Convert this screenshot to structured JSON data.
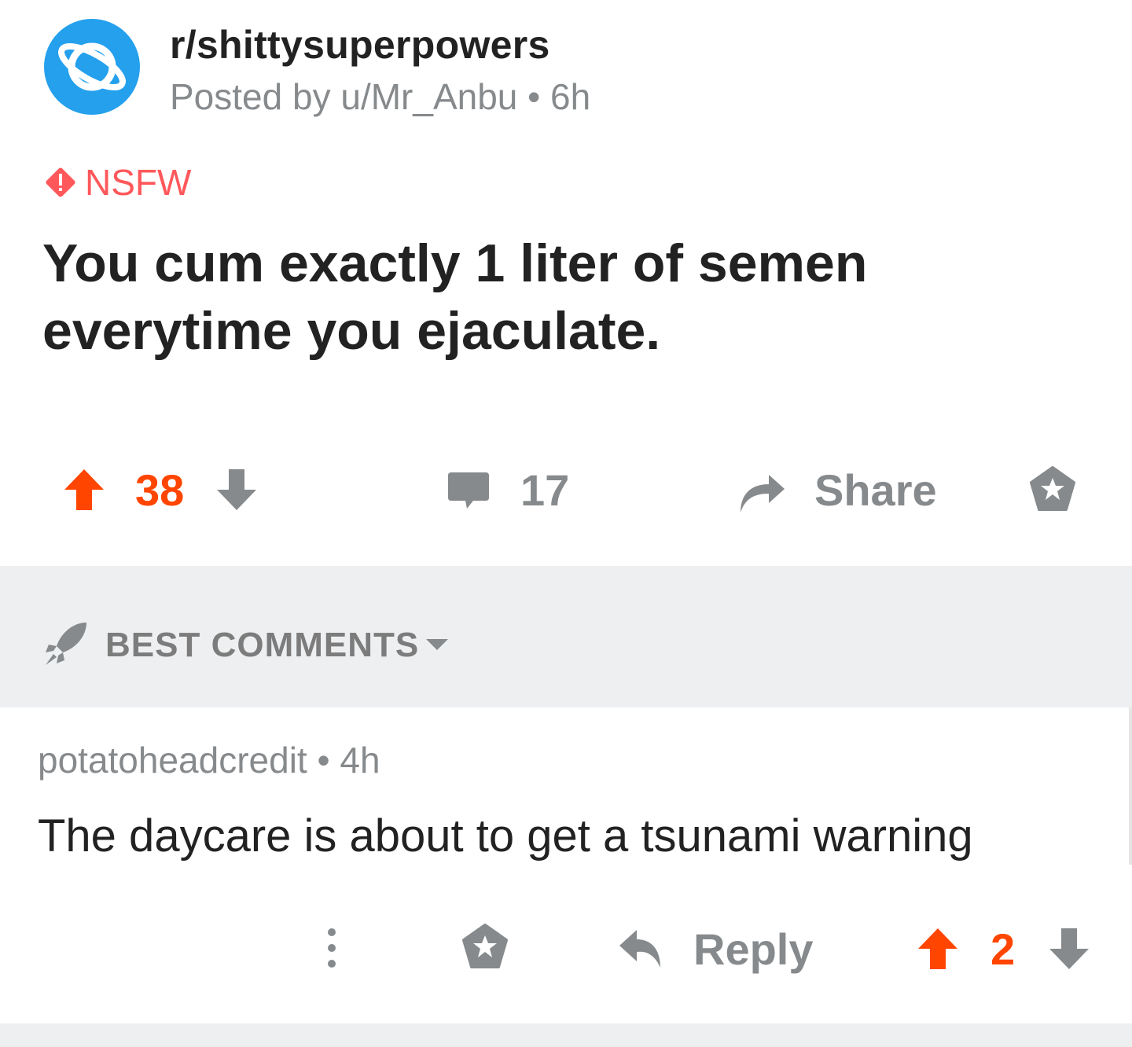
{
  "post": {
    "subreddit": "r/shittysuperpowers",
    "meta": "Posted by u/Mr_Anbu • 6h",
    "nsfw_label": "NSFW",
    "title": "You cum exactly 1 liter of semen everytime you ejaculate.",
    "upvotes": "38",
    "comments": "17",
    "share_label": "Share"
  },
  "sort": {
    "label": "BEST COMMENTS"
  },
  "comment": {
    "meta": "potatoheadcredit • 4h",
    "body": "The daycare is about to get a tsunami warning",
    "reply_label": "Reply",
    "votes": "2"
  },
  "icons": {
    "subreddit_avatar": "planet-icon",
    "nsfw": "warning-diamond-icon",
    "upvote": "arrow-up-icon",
    "downvote": "arrow-down-icon",
    "comments": "speech-bubble-icon",
    "share": "share-arrow-icon",
    "award": "star-award-icon",
    "sort": "rocket-icon",
    "more": "vertical-dots-icon",
    "reply": "reply-arrow-icon"
  },
  "colors": {
    "upvote_active": "#FF4500",
    "nsfw": "#FF585B",
    "avatar": "#24A0ED",
    "muted": "#878A8C",
    "sort_bar_bg": "#EDEFF1"
  }
}
